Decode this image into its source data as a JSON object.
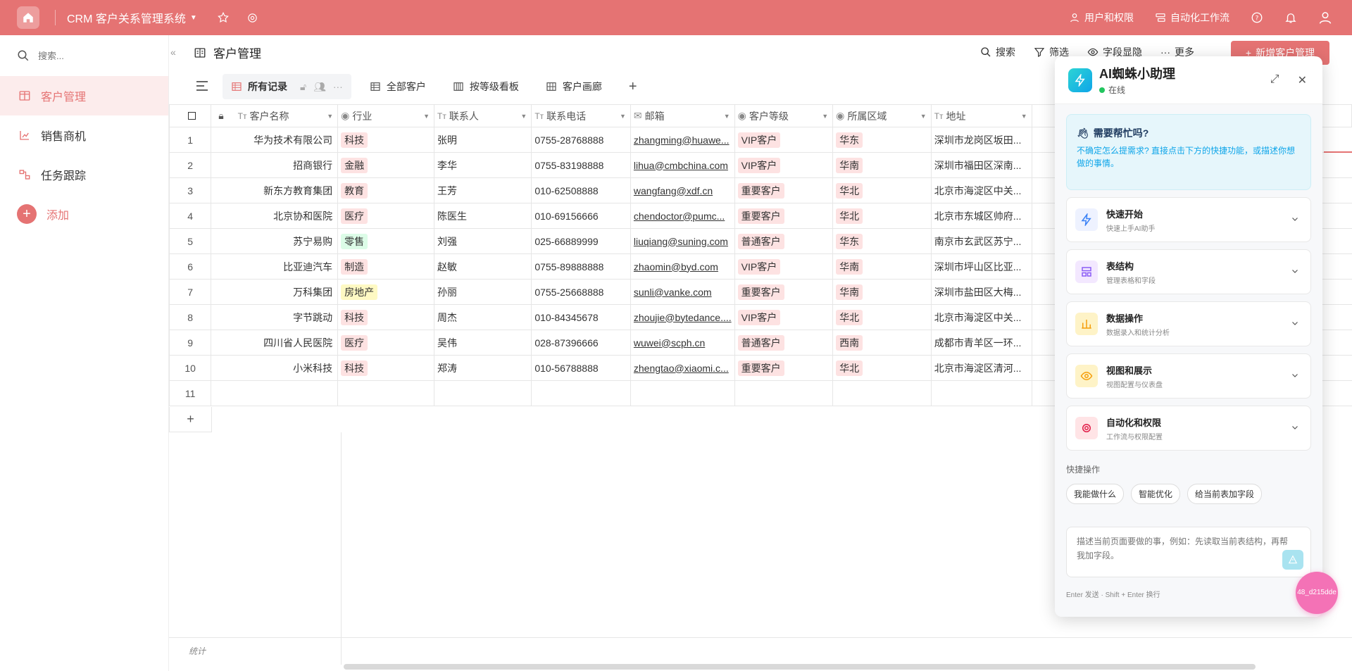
{
  "app": {
    "title": "CRM 客户关系管理系统"
  },
  "topbar": {
    "users_label": "用户和权限",
    "automation_label": "自动化工作流"
  },
  "sidebar": {
    "search_placeholder": "搜索...",
    "items": [
      {
        "label": "客户管理",
        "icon": "table-icon",
        "active": true
      },
      {
        "label": "销售商机",
        "icon": "chart-icon",
        "active": false
      },
      {
        "label": "任务跟踪",
        "icon": "flow-icon",
        "active": false
      }
    ],
    "add_label": "添加"
  },
  "page": {
    "title": "客户管理",
    "actions": {
      "search": "搜索",
      "filter": "筛选",
      "fields": "字段显隐",
      "more": "更多"
    },
    "new_button": "新增客户管理"
  },
  "tabs": [
    {
      "label": "所有记录",
      "active": true
    },
    {
      "label": "全部客户"
    },
    {
      "label": "按等级看板"
    },
    {
      "label": "客户画廊"
    }
  ],
  "table": {
    "columns": [
      {
        "label": "客户名称",
        "icon": "text-icon"
      },
      {
        "label": "行业",
        "icon": "select-icon"
      },
      {
        "label": "联系人",
        "icon": "text-icon"
      },
      {
        "label": "联系电话",
        "icon": "text-icon"
      },
      {
        "label": "邮箱",
        "icon": "email-icon"
      },
      {
        "label": "客户等级",
        "icon": "select-icon"
      },
      {
        "label": "所属区域",
        "icon": "select-icon"
      },
      {
        "label": "地址",
        "icon": "text-icon"
      }
    ],
    "rows": [
      {
        "n": "1",
        "name": "华为技术有限公司",
        "industry": "科技",
        "contact": "张明",
        "phone": "0755-28768888",
        "email": "zhangming@huawe...",
        "level": "VIP客户",
        "region": "华东",
        "address": "深圳市龙岗区坂田..."
      },
      {
        "n": "2",
        "name": "招商银行",
        "industry": "金融",
        "contact": "李华",
        "phone": "0755-83198888",
        "email": "lihua@cmbchina.com",
        "level": "VIP客户",
        "region": "华南",
        "address": "深圳市福田区深南..."
      },
      {
        "n": "3",
        "name": "新东方教育集团",
        "industry": "教育",
        "contact": "王芳",
        "phone": "010-62508888",
        "email": "wangfang@xdf.cn",
        "level": "重要客户",
        "region": "华北",
        "address": "北京市海淀区中关..."
      },
      {
        "n": "4",
        "name": "北京协和医院",
        "industry": "医疗",
        "contact": "陈医生",
        "phone": "010-69156666",
        "email": "chendoctor@pumc...",
        "level": "重要客户",
        "region": "华北",
        "address": "北京市东城区帅府..."
      },
      {
        "n": "5",
        "name": "苏宁易购",
        "industry": "零售",
        "contact": "刘强",
        "phone": "025-66889999",
        "email": "liuqiang@suning.com",
        "level": "普通客户",
        "region": "华东",
        "address": "南京市玄武区苏宁..."
      },
      {
        "n": "6",
        "name": "比亚迪汽车",
        "industry": "制造",
        "contact": "赵敏",
        "phone": "0755-89888888",
        "email": "zhaomin@byd.com",
        "level": "VIP客户",
        "region": "华南",
        "address": "深圳市坪山区比亚..."
      },
      {
        "n": "7",
        "name": "万科集团",
        "industry": "房地产",
        "contact": "孙丽",
        "phone": "0755-25668888",
        "email": "sunli@vanke.com",
        "level": "重要客户",
        "region": "华南",
        "address": "深圳市盐田区大梅..."
      },
      {
        "n": "8",
        "name": "字节跳动",
        "industry": "科技",
        "contact": "周杰",
        "phone": "010-84345678",
        "email": "zhoujie@bytedance....",
        "level": "VIP客户",
        "region": "华北",
        "address": "北京市海淀区中关..."
      },
      {
        "n": "9",
        "name": "四川省人民医院",
        "industry": "医疗",
        "contact": "吴伟",
        "phone": "028-87396666",
        "email": "wuwei@scph.cn",
        "level": "普通客户",
        "region": "西南",
        "address": "成都市青羊区一环..."
      },
      {
        "n": "10",
        "name": "小米科技",
        "industry": "科技",
        "contact": "郑涛",
        "phone": "010-56788888",
        "email": "zhengtao@xiaomi.c...",
        "level": "重要客户",
        "region": "华北",
        "address": "北京市海淀区清河..."
      },
      {
        "n": "11",
        "name": "",
        "industry": "",
        "contact": "",
        "phone": "",
        "email": "",
        "level": "",
        "region": "",
        "address": ""
      }
    ],
    "add_row": "+",
    "footer_label": "统计"
  },
  "colors": {
    "accent": "#e57373",
    "industry": {
      "科技": "#fde2e2",
      "金融": "#fde2e2",
      "教育": "#fde2e2",
      "医疗": "#fde2e2",
      "零售": "#dcfce7",
      "制造": "#fde2e2",
      "房地产": "#fef9c3"
    },
    "level_bg": "#fde2e2",
    "region_bg": "#fde2e2"
  },
  "assistant": {
    "title": "AI蜘蛛小助理",
    "status": "在线",
    "help_title": "需要帮忙吗?",
    "help_desc": "不确定怎么提需求? 直接点击下方的快捷功能，或描述你想做的事情。",
    "categories": [
      {
        "title": "快速开始",
        "desc": "快速上手AI助手",
        "color": "#3b82f6",
        "bg": "#eef2ff",
        "icon": "lightning-icon"
      },
      {
        "title": "表结构",
        "desc": "管理表格和字段",
        "color": "#8b5cf6",
        "bg": "#f3e8ff",
        "icon": "layout-icon"
      },
      {
        "title": "数据操作",
        "desc": "数据录入和统计分析",
        "color": "#f59e0b",
        "bg": "#fef3c7",
        "icon": "bar-chart-icon"
      },
      {
        "title": "视图和展示",
        "desc": "视图配置与仪表盘",
        "color": "#f59e0b",
        "bg": "#fef3c7",
        "icon": "eye-icon"
      },
      {
        "title": "自动化和权限",
        "desc": "工作流与权限配置",
        "color": "#e11d48",
        "bg": "#ffe4e6",
        "icon": "gear-icon"
      }
    ],
    "quick_label": "快捷操作",
    "chips": [
      "我能做什么",
      "智能优化",
      "给当前表加字段"
    ],
    "input_placeholder": "描述当前页面要做的事，例如：先读取当前表结构，再帮我加字段。",
    "hint": "Enter 发送 · Shift + Enter 换行"
  },
  "floating_avatar": {
    "label": "48_d215dde"
  }
}
